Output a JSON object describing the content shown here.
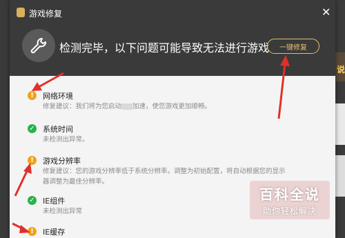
{
  "dialog": {
    "title": "游戏修复",
    "close_glyph": "✕",
    "headline": "检测完毕，以下问题可能导致无法进行游戏",
    "fix_button": "一键修复"
  },
  "items": [
    {
      "status": "warning",
      "icon": "warning-icon",
      "title": "网络环境",
      "desc_prefix": "修复建议：我们将为您启动",
      "desc_suffix": "加速，使您游戏更加顺畅。"
    },
    {
      "status": "ok",
      "icon": "check-icon",
      "title": "系统时间",
      "desc": "未检测出异常。"
    },
    {
      "status": "warning",
      "icon": "warning-icon",
      "title": "游戏分辨率",
      "desc": "修复建议：您的游戏分辨率低于系统分辨率。调整为初始配置，将自动根据您的显示器调整为最佳分辨率。"
    },
    {
      "status": "ok",
      "icon": "check-icon",
      "title": "IE组件",
      "desc": "未检测出异常"
    },
    {
      "status": "warning",
      "icon": "warning-icon",
      "title": "IE缓存",
      "desc": ""
    }
  ],
  "background": {
    "edge_char": "说"
  },
  "watermark": {
    "title": "百科全说",
    "subtitle": "助你轻松解决"
  },
  "colors": {
    "header_bg": "#3a3a3a",
    "accent_gold": "#e5c06a",
    "warning": "#f0a21c",
    "ok": "#29b24a",
    "arrow_red": "#e0302a"
  }
}
